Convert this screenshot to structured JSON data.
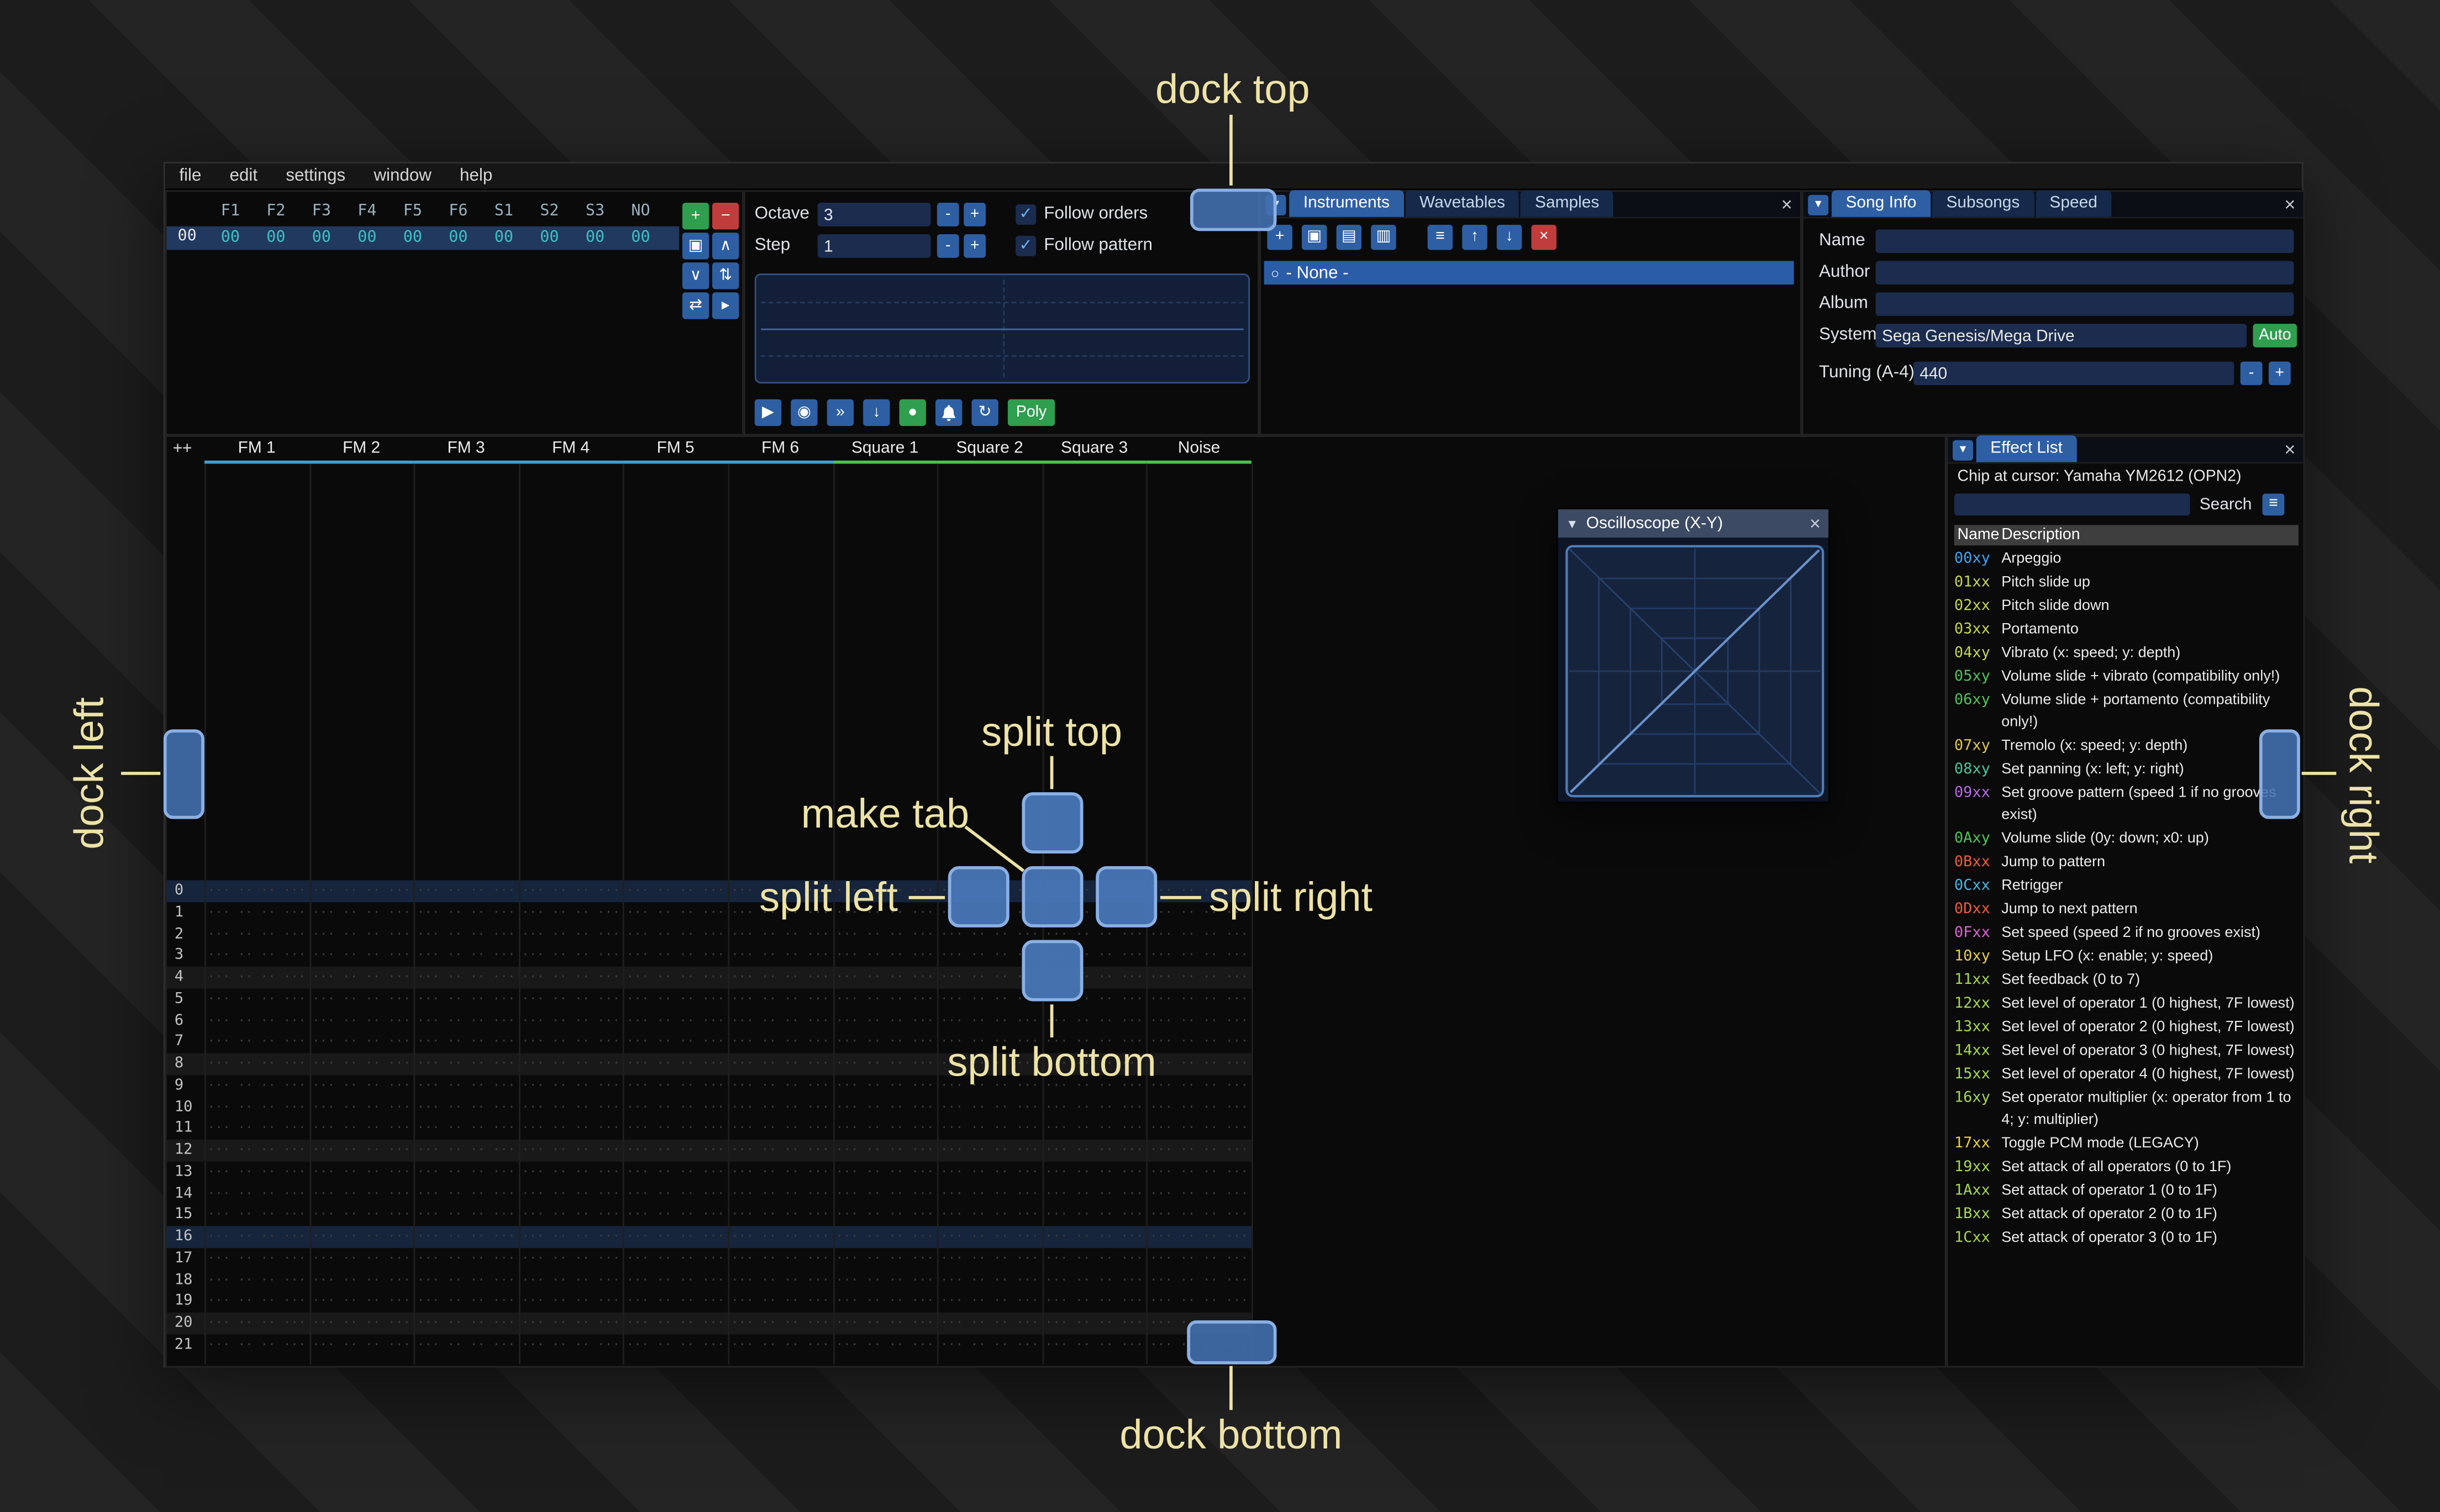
{
  "icons": {
    "close": "×",
    "panel_menu": "▾",
    "collapse": "▼",
    "hamburger": "≡",
    "bullet": "○",
    "check": "✓"
  },
  "menu": {
    "items": [
      "file",
      "edit",
      "settings",
      "window",
      "help"
    ]
  },
  "orders": {
    "channel_headers": [
      "F1",
      "F2",
      "F3",
      "F4",
      "F5",
      "F6",
      "S1",
      "S2",
      "S3",
      "NO"
    ],
    "rows": [
      {
        "num": "00",
        "selected": true,
        "values": [
          "00",
          "00",
          "00",
          "00",
          "00",
          "00",
          "00",
          "00",
          "00",
          "00"
        ]
      }
    ],
    "toolbar": [
      {
        "name": "add-order",
        "glyph": "+",
        "style": "green"
      },
      {
        "name": "remove-order",
        "glyph": "−",
        "style": "red"
      },
      {
        "name": "duplicate-order",
        "glyph": "▣",
        "style": "blue"
      },
      {
        "name": "move-order-up",
        "glyph": "∧",
        "style": "blue"
      },
      {
        "name": "move-order-down",
        "glyph": "∨",
        "style": "blue"
      },
      {
        "name": "deep-clone-order",
        "glyph": "⇅",
        "style": "blue"
      },
      {
        "name": "change-all-orders",
        "glyph": "⇄",
        "style": "blue"
      },
      {
        "name": "order-edit-mode",
        "glyph": "▸",
        "style": "blue"
      }
    ]
  },
  "play_controls": {
    "octave_label": "Octave",
    "octave_value": "3",
    "step_label": "Step",
    "step_value": "1",
    "dec_label": "-",
    "inc_label": "+",
    "follow_orders_label": "Follow orders",
    "follow_pattern_label": "Follow pattern",
    "transport": [
      {
        "name": "play",
        "glyph": "▶",
        "style": "blue"
      },
      {
        "name": "play-from-beginning",
        "glyph": "◉",
        "style": "blue"
      },
      {
        "name": "play-one-row",
        "glyph": "»",
        "style": "blue"
      },
      {
        "name": "stop",
        "glyph": "↓",
        "style": "blue"
      },
      {
        "name": "edit-record-toggle",
        "glyph": "●",
        "style": "green"
      },
      {
        "name": "metronome",
        "glyph": "bell",
        "style": "blue"
      },
      {
        "name": "repeat-pattern",
        "glyph": "↻",
        "style": "blue"
      },
      {
        "name": "polyphony-toggle",
        "glyph": "Poly",
        "style": "green-wide"
      }
    ]
  },
  "instruments": {
    "tabs": [
      {
        "label": "Instruments",
        "active": true
      },
      {
        "label": "Wavetables",
        "active": false
      },
      {
        "label": "Samples",
        "active": false
      }
    ],
    "toolbar": [
      {
        "name": "add-instrument",
        "glyph": "+",
        "style": "blue"
      },
      {
        "name": "duplicate-instrument",
        "glyph": "▣",
        "style": "blue"
      },
      {
        "name": "open-instrument",
        "glyph": "▤",
        "style": "blue"
      },
      {
        "name": "save-instrument",
        "glyph": "▥",
        "style": "blue"
      },
      {
        "name": "instrument-folders",
        "glyph": "≡",
        "style": "blue"
      },
      {
        "name": "move-instrument-up",
        "glyph": "↑",
        "style": "blue"
      },
      {
        "name": "move-instrument-down",
        "glyph": "↓",
        "style": "blue"
      },
      {
        "name": "delete-instrument",
        "glyph": "×",
        "style": "red"
      }
    ],
    "list": [
      {
        "label": "- None -",
        "selected": true
      }
    ]
  },
  "song_info": {
    "tabs": [
      {
        "label": "Song Info",
        "active": true
      },
      {
        "label": "Subsongs",
        "active": false
      },
      {
        "label": "Speed",
        "active": false
      }
    ],
    "name_label": "Name",
    "name_value": "",
    "author_label": "Author",
    "author_value": "",
    "album_label": "Album",
    "album_value": "",
    "system_label": "System",
    "system_value": "Sega Genesis/Mega Drive",
    "auto_label": "Auto",
    "tuning_label": "Tuning (A-4)",
    "tuning_value": "440",
    "dec_label": "-",
    "inc_label": "+"
  },
  "pattern": {
    "corner_label": "++",
    "channels": [
      {
        "name": "FM 1",
        "color": "#3f9fd0"
      },
      {
        "name": "FM 2",
        "color": "#3f9fd0"
      },
      {
        "name": "FM 3",
        "color": "#3f9fd0"
      },
      {
        "name": "FM 4",
        "color": "#3f9fd0"
      },
      {
        "name": "FM 5",
        "color": "#3f9fd0"
      },
      {
        "name": "FM 6",
        "color": "#3f9fd0"
      },
      {
        "name": "Square 1",
        "color": "#4cc24c"
      },
      {
        "name": "Square 2",
        "color": "#4cc24c"
      },
      {
        "name": "Square 3",
        "color": "#4cc24c"
      },
      {
        "name": "Noise",
        "color": "#4cc24c"
      }
    ],
    "row_count": 22,
    "cell_placeholder": "··· ·· ·· ···",
    "highlight_major_rows": [
      0,
      16
    ],
    "highlight_minor_rows": [
      4,
      8,
      12,
      20
    ]
  },
  "oscilloscope_window": {
    "title": "Oscilloscope (X-Y)"
  },
  "effect_list": {
    "tab_label": "Effect List",
    "chip_line": "Chip at cursor: Yamaha YM2612 (OPN2)",
    "search_label": "Search",
    "name_column": "Name",
    "description_column": "Description",
    "effects": [
      {
        "code": "00xy",
        "color": "#3fa5f5",
        "desc": "Arpeggio"
      },
      {
        "code": "01xx",
        "color": "#c7d54d",
        "desc": "Pitch slide up"
      },
      {
        "code": "02xx",
        "color": "#c7d54d",
        "desc": "Pitch slide down"
      },
      {
        "code": "03xx",
        "color": "#c7d54d",
        "desc": "Portamento"
      },
      {
        "code": "04xy",
        "color": "#c7d54d",
        "desc": "Vibrato (x: speed; y: depth)"
      },
      {
        "code": "05xy",
        "color": "#4fc457",
        "desc": "Volume slide + vibrato (compatibility only!)"
      },
      {
        "code": "06xy",
        "color": "#4fc457",
        "desc": "Volume slide + portamento (compatibility only!)"
      },
      {
        "code": "07xy",
        "color": "#e0c94f",
        "desc": "Tremolo (x: speed; y: depth)"
      },
      {
        "code": "08xy",
        "color": "#47c7a2",
        "desc": "Set panning (x: left; y: right)"
      },
      {
        "code": "09xx",
        "color": "#b66be8",
        "desc": "Set groove pattern (speed 1 if no grooves exist)"
      },
      {
        "code": "0Axy",
        "color": "#4fc457",
        "desc": "Volume slide (0y: down; x0: up)"
      },
      {
        "code": "0Bxx",
        "color": "#f25a3e",
        "desc": "Jump to pattern"
      },
      {
        "code": "0Cxx",
        "color": "#44b8e8",
        "desc": "Retrigger"
      },
      {
        "code": "0Dxx",
        "color": "#f25a3e",
        "desc": "Jump to next pattern"
      },
      {
        "code": "0Fxx",
        "color": "#e060d8",
        "desc": "Set speed (speed 2 if no grooves exist)"
      },
      {
        "code": "10xy",
        "color": "#e8cf4a",
        "desc": "Setup LFO (x: enable; y: speed)"
      },
      {
        "code": "11xx",
        "color": "#a6d94c",
        "desc": "Set feedback (0 to 7)"
      },
      {
        "code": "12xx",
        "color": "#a6d94c",
        "desc": "Set level of operator 1 (0 highest, 7F lowest)"
      },
      {
        "code": "13xx",
        "color": "#a6d94c",
        "desc": "Set level of operator 2 (0 highest, 7F lowest)"
      },
      {
        "code": "14xx",
        "color": "#a6d94c",
        "desc": "Set level of operator 3 (0 highest, 7F lowest)"
      },
      {
        "code": "15xx",
        "color": "#a6d94c",
        "desc": "Set level of operator 4 (0 highest, 7F lowest)"
      },
      {
        "code": "16xy",
        "color": "#a6d94c",
        "desc": "Set operator multiplier (x: operator from 1 to 4; y: multiplier)"
      },
      {
        "code": "17xx",
        "color": "#e8cf4a",
        "desc": "Toggle PCM mode (LEGACY)"
      },
      {
        "code": "19xx",
        "color": "#a6d94c",
        "desc": "Set attack of all operators (0 to 1F)"
      },
      {
        "code": "1Axx",
        "color": "#a6d94c",
        "desc": "Set attack of operator 1 (0 to 1F)"
      },
      {
        "code": "1Bxx",
        "color": "#a6d94c",
        "desc": "Set attack of operator 2 (0 to 1F)"
      },
      {
        "code": "1Cxx",
        "color": "#a6d94c",
        "desc": "Set attack of operator 3 (0 to 1F)"
      }
    ]
  },
  "overlay": {
    "dock_top": "dock top",
    "dock_bottom": "dock bottom",
    "dock_left": "dock left",
    "dock_right": "dock right",
    "split_top": "split top",
    "split_bottom": "split bottom",
    "split_left": "split left",
    "split_right": "split right",
    "make_tab": "make tab",
    "hint_color": "#ede3a6"
  }
}
